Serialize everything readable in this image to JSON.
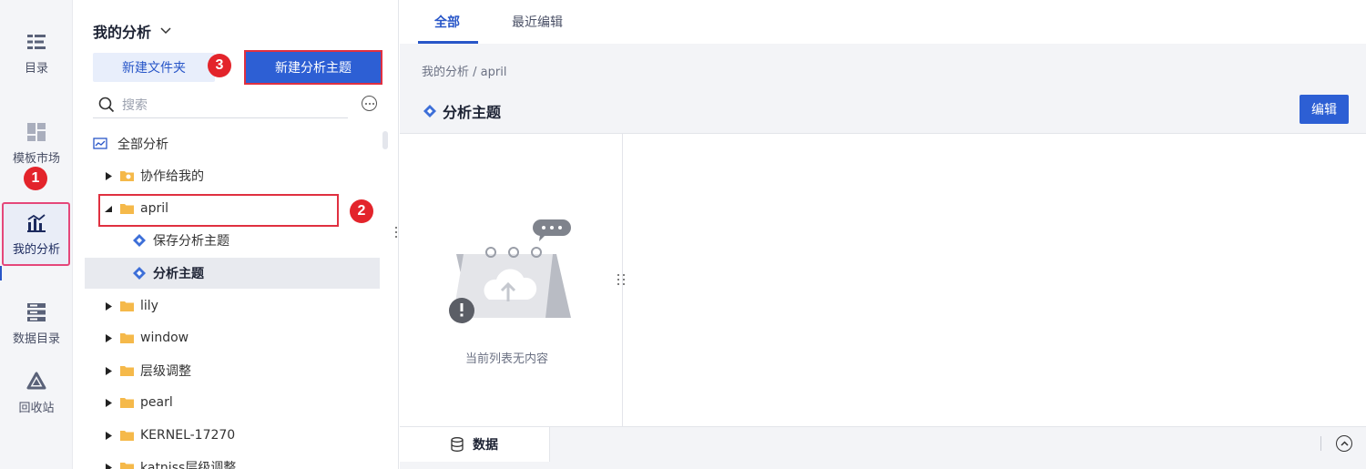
{
  "rail": {
    "items": [
      {
        "label": "目录",
        "icon": "catalog-icon"
      },
      {
        "label": "模板市场",
        "icon": "template-market-icon"
      },
      {
        "label": "我的分析",
        "icon": "my-analysis-icon"
      },
      {
        "label": "数据目录",
        "icon": "data-catalog-icon"
      },
      {
        "label": "回收站",
        "icon": "recycle-bin-icon"
      }
    ]
  },
  "tree": {
    "title": "我的分析",
    "new_folder_label": "新建文件夹",
    "new_topic_label": "新建分析主题",
    "search_placeholder": "搜索",
    "rows": [
      {
        "label": "全部分析"
      },
      {
        "label": "协作给我的"
      },
      {
        "label": "april"
      },
      {
        "label": "保存分析主题"
      },
      {
        "label": "分析主题"
      },
      {
        "label": "lily"
      },
      {
        "label": "window"
      },
      {
        "label": "层级调整"
      },
      {
        "label": "pearl"
      },
      {
        "label": "KERNEL-17270"
      },
      {
        "label": "katniss层级调整"
      }
    ]
  },
  "badges": [
    "1",
    "2",
    "3"
  ],
  "tabs": {
    "all": "全部",
    "recent": "最近编辑"
  },
  "main": {
    "breadcrumb": "我的分析  /  april",
    "topic_title": "分析主题",
    "edit_label": "编辑",
    "empty_text": "当前列表无内容",
    "data_tab_label": "数据"
  },
  "colors": {
    "accent": "#2d5fd4",
    "highlight": "#e03040",
    "badge": "#e3242b",
    "folder": "#f5b94a"
  }
}
